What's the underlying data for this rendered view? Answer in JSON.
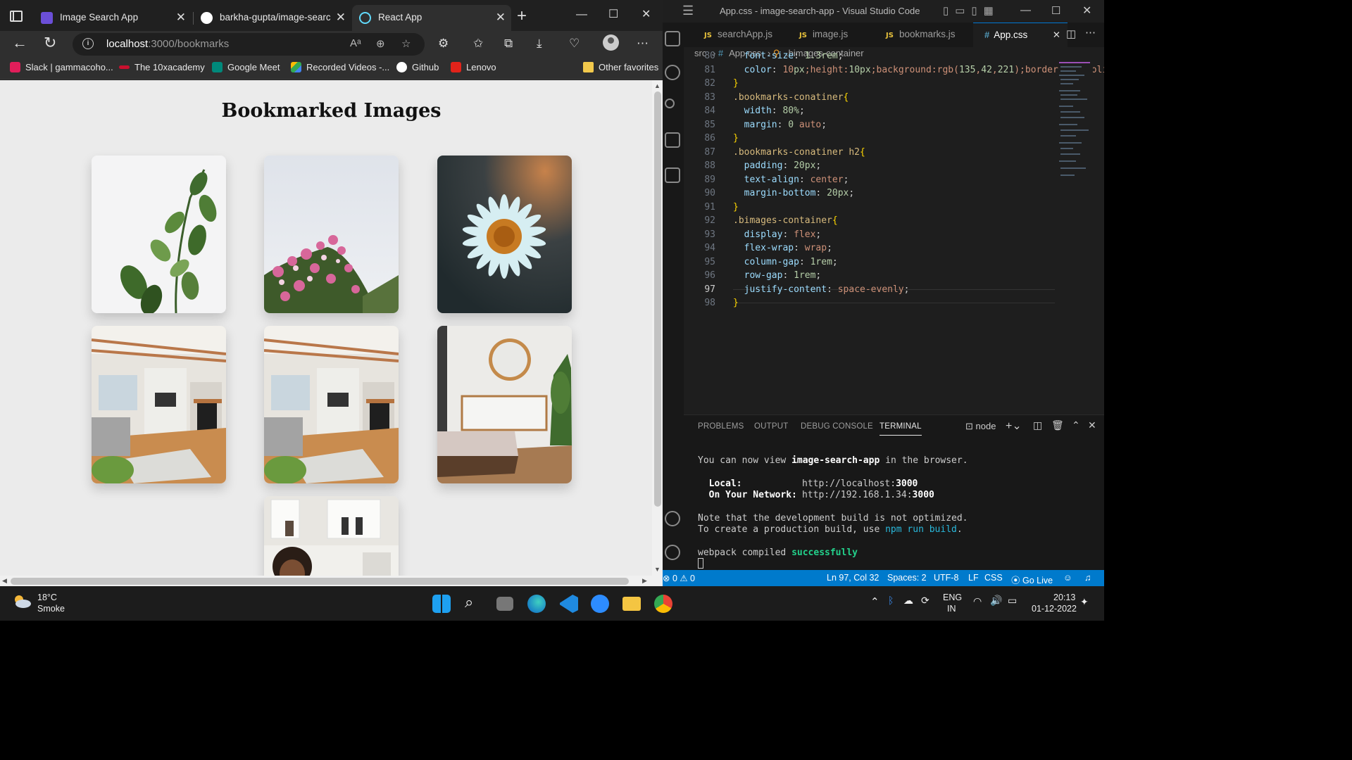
{
  "browser": {
    "tabs": [
      {
        "title": "Image Search App",
        "favicon_color": "#6b4fd8"
      },
      {
        "title": "barkha-gupta/image-search-",
        "favicon_color": "#ffffff"
      },
      {
        "title": "React App",
        "favicon_color": "#61dafb"
      }
    ],
    "url_host": "localhost",
    "url_path": ":3000/bookmarks",
    "favorites": [
      {
        "label": "Slack | gammacoho...",
        "color": "#e01e5a"
      },
      {
        "label": "The 10xacademy",
        "color": "#c8102e"
      },
      {
        "label": "Google Meet",
        "color": "#00897b"
      },
      {
        "label": "Recorded Videos -...",
        "color": "#4285f4"
      },
      {
        "label": "Github",
        "color": "#ffffff"
      },
      {
        "label": "Lenovo",
        "color": "#e2231a"
      }
    ],
    "other_favorites": "Other favorites"
  },
  "page": {
    "heading": "Bookmarked Images",
    "images": [
      {
        "subject": "eucalyptus branch"
      },
      {
        "subject": "pink blossoms"
      },
      {
        "subject": "white daisy"
      },
      {
        "subject": "living room"
      },
      {
        "subject": "living room"
      },
      {
        "subject": "bedroom with mirror"
      },
      {
        "subject": "woman at shelves"
      }
    ]
  },
  "vscode": {
    "window_title": "App.css - image-search-app - Visual Studio Code",
    "tabs": [
      {
        "label": "searchApp.js",
        "kind": "JS"
      },
      {
        "label": "image.js",
        "kind": "JS"
      },
      {
        "label": "bookmarks.js",
        "kind": "JS"
      },
      {
        "label": "App.css",
        "kind": "#"
      }
    ],
    "breadcrumb": [
      "src",
      "App.css",
      ".bimages-container"
    ],
    "code_lines": [
      {
        "n": "80",
        "text": "  font-size: 1.3rem;"
      },
      {
        "n": "81",
        "text": "  color: ■rgb(135, 42, 221);"
      },
      {
        "n": "82",
        "text": "}"
      },
      {
        "n": "83",
        "text": ".bookmarks-conatiner{"
      },
      {
        "n": "84",
        "text": "  width: 80%;"
      },
      {
        "n": "85",
        "text": "  margin: 0 auto;"
      },
      {
        "n": "86",
        "text": "}"
      },
      {
        "n": "87",
        "text": ".bookmarks-conatiner h2{"
      },
      {
        "n": "88",
        "text": "  padding: 20px;"
      },
      {
        "n": "89",
        "text": "  text-align: center;"
      },
      {
        "n": "90",
        "text": "  margin-bottom: 20px;"
      },
      {
        "n": "91",
        "text": "}"
      },
      {
        "n": "92",
        "text": ".bimages-container{"
      },
      {
        "n": "93",
        "text": "  display: flex;"
      },
      {
        "n": "94",
        "text": "  flex-wrap: wrap;"
      },
      {
        "n": "95",
        "text": "  column-gap: 1rem;"
      },
      {
        "n": "96",
        "text": "  row-gap: 1rem;"
      },
      {
        "n": "97",
        "text": "  justify-content: space-evenly;"
      },
      {
        "n": "98",
        "text": "}"
      }
    ],
    "panel_tabs": [
      "PROBLEMS",
      "OUTPUT",
      "DEBUG CONSOLE",
      "TERMINAL"
    ],
    "terminal_name": "node",
    "terminal": {
      "line1_a": "You can now view ",
      "line1_b": "image-search-app",
      "line1_c": " in the browser.",
      "local_label": "  Local:",
      "local_url": "http://localhost:",
      "local_port": "3000",
      "network_label": "  On Your Network:",
      "network_url": "http://192.168.1.34:",
      "network_port": "3000",
      "note1": "Note that the development build is not optimized.",
      "note2_a": "To create a production build, use ",
      "note2_b": "npm run build",
      "note2_c": ".",
      "compiled_a": "webpack compiled ",
      "compiled_b": "successfully"
    },
    "status": {
      "problems": "⊗ 0 ⚠ 0",
      "cursor": "Ln 97, Col 32",
      "spaces": "Spaces: 2",
      "encoding": "UTF-8",
      "eol": "LF",
      "language": "CSS",
      "golive": "Go Live"
    }
  },
  "taskbar": {
    "temperature": "18°C",
    "weather": "Smoke",
    "lang1": "ENG",
    "lang2": "IN",
    "time": "20:13",
    "date": "01-12-2022"
  }
}
